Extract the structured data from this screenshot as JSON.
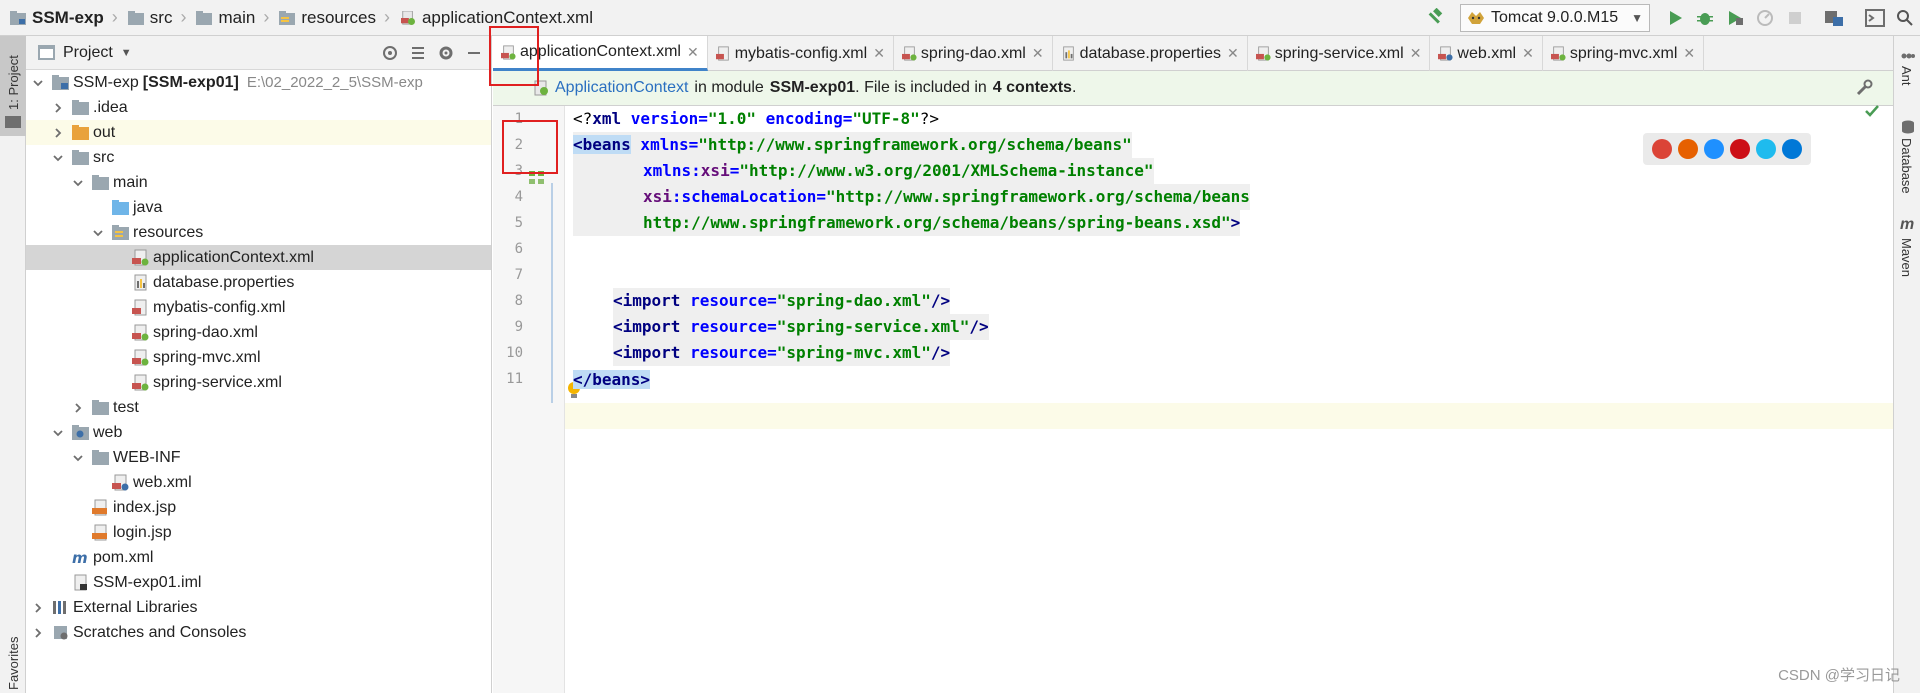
{
  "breadcrumb": {
    "items": [
      "SSM-exp",
      "src",
      "main",
      "resources",
      "applicationContext.xml"
    ]
  },
  "run_config": {
    "label": "Tomcat 9.0.0.M15"
  },
  "left_strip": {
    "project_label": "1: Project",
    "favorites_label": "Favorites"
  },
  "right_strip": {
    "ant_label": "Ant",
    "database_label": "Database",
    "maven_label": "Maven"
  },
  "project_panel": {
    "title": "Project",
    "tree": [
      {
        "label": "SSM-exp",
        "bold": "[SSM-exp01]",
        "path": "E:\\02_2022_2_5\\SSM-exp",
        "depth": 0,
        "arrow": "down",
        "icon": "module-folder-icon"
      },
      {
        "label": ".idea",
        "depth": 1,
        "arrow": "right",
        "icon": "folder-icon"
      },
      {
        "label": "out",
        "depth": 1,
        "arrow": "right",
        "icon": "orange-folder-icon",
        "hl": true
      },
      {
        "label": "src",
        "depth": 1,
        "arrow": "down",
        "icon": "folder-icon"
      },
      {
        "label": "main",
        "depth": 2,
        "arrow": "down",
        "icon": "folder-icon"
      },
      {
        "label": "java",
        "depth": 3,
        "arrow": "",
        "icon": "blue-folder-icon"
      },
      {
        "label": "resources",
        "depth": 3,
        "arrow": "down",
        "icon": "resources-folder-icon"
      },
      {
        "label": "applicationContext.xml",
        "depth": 4,
        "arrow": "",
        "icon": "spring-xml-icon",
        "selected": true
      },
      {
        "label": "database.properties",
        "depth": 4,
        "arrow": "",
        "icon": "properties-icon"
      },
      {
        "label": "mybatis-config.xml",
        "depth": 4,
        "arrow": "",
        "icon": "xml-icon"
      },
      {
        "label": "spring-dao.xml",
        "depth": 4,
        "arrow": "",
        "icon": "spring-xml-icon"
      },
      {
        "label": "spring-mvc.xml",
        "depth": 4,
        "arrow": "",
        "icon": "spring-xml-icon"
      },
      {
        "label": "spring-service.xml",
        "depth": 4,
        "arrow": "",
        "icon": "spring-xml-icon"
      },
      {
        "label": "test",
        "depth": 2,
        "arrow": "right",
        "icon": "folder-icon"
      },
      {
        "label": "web",
        "depth": 1,
        "arrow": "down",
        "icon": "web-folder-icon"
      },
      {
        "label": "WEB-INF",
        "depth": 2,
        "arrow": "down",
        "icon": "folder-icon"
      },
      {
        "label": "web.xml",
        "depth": 3,
        "arrow": "",
        "icon": "web-xml-icon"
      },
      {
        "label": "index.jsp",
        "depth": 2,
        "arrow": "",
        "icon": "jsp-icon"
      },
      {
        "label": "login.jsp",
        "depth": 2,
        "arrow": "",
        "icon": "jsp-icon"
      },
      {
        "label": "pom.xml",
        "depth": 1,
        "arrow": "",
        "icon": "maven-icon"
      },
      {
        "label": "SSM-exp01.iml",
        "depth": 1,
        "arrow": "",
        "icon": "iml-icon"
      },
      {
        "label": "External Libraries",
        "depth": 0,
        "arrow": "right",
        "icon": "libraries-icon"
      },
      {
        "label": "Scratches and Consoles",
        "depth": 0,
        "arrow": "right",
        "icon": "scratches-icon"
      }
    ]
  },
  "tabs": [
    {
      "label": "applicationContext.xml",
      "active": true,
      "icon": "spring-xml-icon"
    },
    {
      "label": "mybatis-config.xml",
      "active": false,
      "icon": "xml-icon"
    },
    {
      "label": "spring-dao.xml",
      "active": false,
      "icon": "spring-xml-icon"
    },
    {
      "label": "database.properties",
      "active": false,
      "icon": "properties-icon"
    },
    {
      "label": "spring-service.xml",
      "active": false,
      "icon": "spring-xml-icon"
    },
    {
      "label": "web.xml",
      "active": false,
      "icon": "web-xml-icon"
    },
    {
      "label": "spring-mvc.xml",
      "active": false,
      "icon": "spring-xml-icon"
    }
  ],
  "banner": {
    "link": "ApplicationContext",
    "text1": "in module",
    "module": "SSM-exp01",
    "text2": ". File is included in",
    "contexts": "4 contexts",
    "text3": "."
  },
  "code": {
    "line_numbers": [
      "1",
      "2",
      "3",
      "4",
      "5",
      "6",
      "7",
      "8",
      "9",
      "10",
      "11"
    ],
    "l1_a": "<?",
    "l1_b": "xml ",
    "l1_c": "version=",
    "l1_d": "\"1.0\" ",
    "l1_e": "encoding=",
    "l1_f": "\"UTF-8\"",
    "l1_g": "?>",
    "l2_a": "<beans",
    "l2_b": " xmlns=",
    "l2_c": "\"http://www.springframework.org/schema/beans\"",
    "l3_a": "xmlns:",
    "l3_b": "xsi",
    "l3_c": "=",
    "l3_d": "\"http://www.w3.org/2001/XMLSchema-instance\"",
    "l4_a": "xsi",
    "l4_b": ":schemaLocation=",
    "l4_c": "\"http://www.springframework.org/schema/beans",
    "l5_a": "http://www.springframework.org/schema/beans/spring-beans.xsd\"",
    "l5_b": ">",
    "l7_a": "<import ",
    "l7_b": "resource=",
    "l7_c": "\"spring-dao.xml\"",
    "l7_d": "/>",
    "l8_a": "<import ",
    "l8_b": "resource=",
    "l8_c": "\"spring-service.xml\"",
    "l8_d": "/>",
    "l9_a": "<import ",
    "l9_b": "resource=",
    "l9_c": "\"spring-mvc.xml\"",
    "l9_d": "/>",
    "l11": "</beans>"
  },
  "browsers": [
    "chrome-icon",
    "firefox-icon",
    "safari-icon",
    "opera-icon",
    "ie-icon",
    "edge-icon"
  ],
  "watermark": "CSDN @学习日记"
}
